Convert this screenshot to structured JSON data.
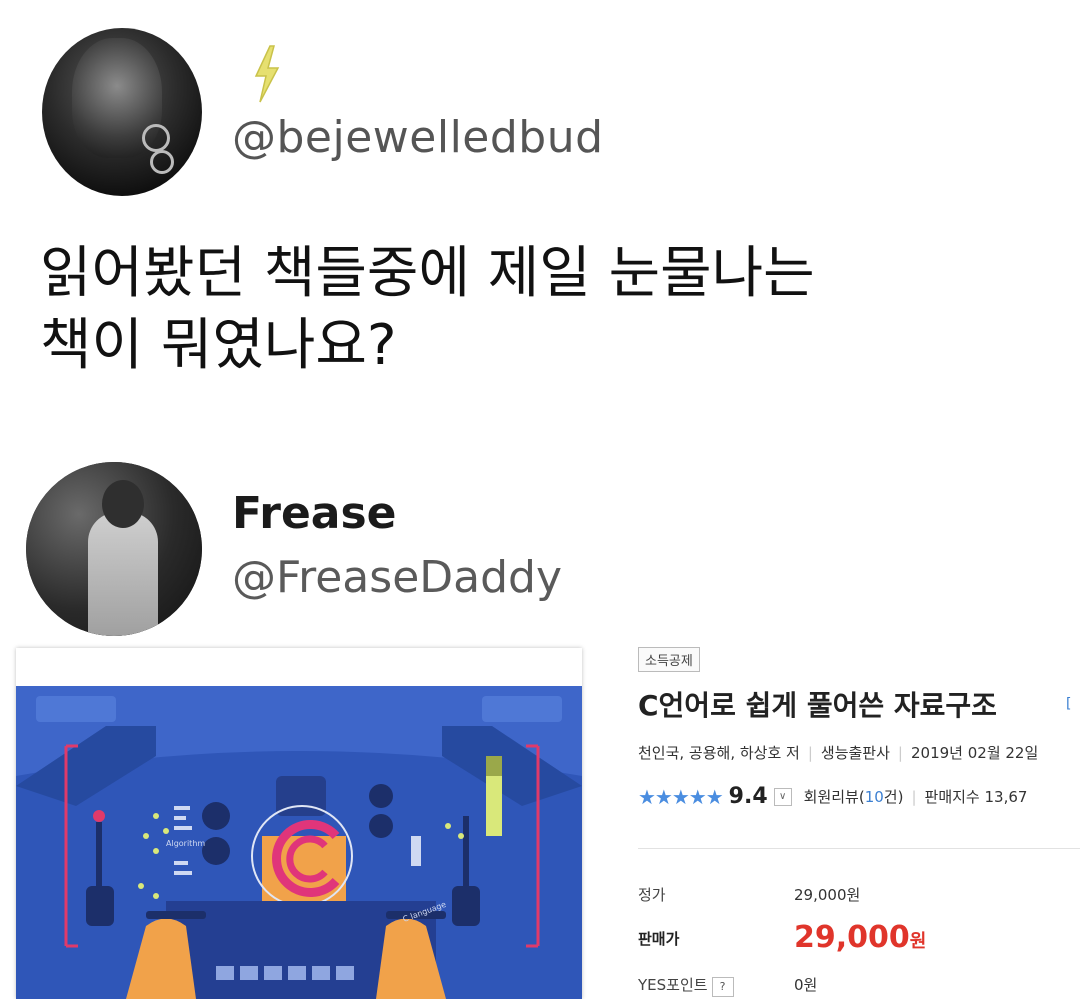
{
  "tweet1": {
    "handle": "@bejewelledbud",
    "text_line1": "읽어봤던 책들중에 제일 눈물나는",
    "text_line2": "책이 뭐였나요?"
  },
  "tweet2": {
    "name": "Frease",
    "handle": "@FreaseDaddy"
  },
  "cover": {
    "label_algorithm": "Algorithm",
    "label_c_language": "C language"
  },
  "product": {
    "tag": "소득공제",
    "title": "C언어로 쉽게 풀어쓴 자료구조",
    "title_bracket": "[",
    "authors": "천인국, 공용해, 하상호 저",
    "publisher": "생능출판사",
    "date": "2019년 02월 22일",
    "stars": "★★★★★",
    "score": "9.4",
    "score_dropdown": "∨",
    "reviews_prefix": "회원리뷰(",
    "reviews_count": "10",
    "reviews_suffix": "건)",
    "sales_index": "판매지수 13,67",
    "list_price_label": "정가",
    "list_price": "29,000원",
    "sale_price_label": "판매가",
    "sale_price": "29,000",
    "sale_price_unit": "원",
    "points_label": "YES포인트",
    "points_help": "?",
    "points_value": "0원"
  },
  "colors": {
    "accent_blue": "#3b7fd1",
    "price_red": "#e0352b",
    "cover_blue": "#2f56b8"
  }
}
